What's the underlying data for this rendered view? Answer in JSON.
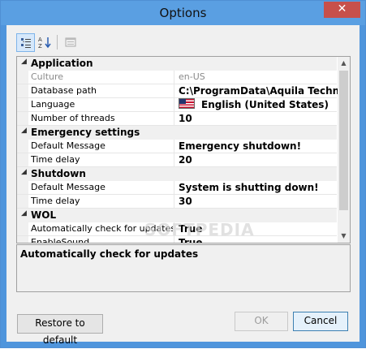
{
  "window": {
    "title": "Options",
    "close_label": "✕"
  },
  "toolbar": {
    "categorized_icon": "categorized-icon",
    "alphabetical_icon": "sort-alphabetical-icon",
    "pages_icon": "property-pages-icon"
  },
  "grid": {
    "collapse_glyph": "◢",
    "categories": [
      {
        "label": "Application",
        "properties": [
          {
            "name": "Culture",
            "value": "en-US",
            "disabled": true
          },
          {
            "name": "Database path",
            "value": "C:\\ProgramData\\Aquila Technology"
          },
          {
            "name": "Language",
            "value": "English (United States)",
            "flag": "us-flag-icon"
          },
          {
            "name": "Number of threads",
            "value": "10"
          }
        ]
      },
      {
        "label": "Emergency settings",
        "properties": [
          {
            "name": "Default Message",
            "value": "Emergency shutdown!"
          },
          {
            "name": "Time delay",
            "value": "20"
          }
        ]
      },
      {
        "label": "Shutdown",
        "properties": [
          {
            "name": "Default Message",
            "value": "System is shutting down!"
          },
          {
            "name": "Time delay",
            "value": "30"
          }
        ]
      },
      {
        "label": "WOL",
        "properties": [
          {
            "name": "Automatically check for updates",
            "value": "True"
          },
          {
            "name": "EnableSound",
            "value": "True"
          }
        ]
      }
    ]
  },
  "description": {
    "title": "Automatically check for updates"
  },
  "buttons": {
    "restore": "Restore to default",
    "ok": "OK",
    "cancel": "Cancel"
  },
  "watermark": "SOFTPEDIA"
}
